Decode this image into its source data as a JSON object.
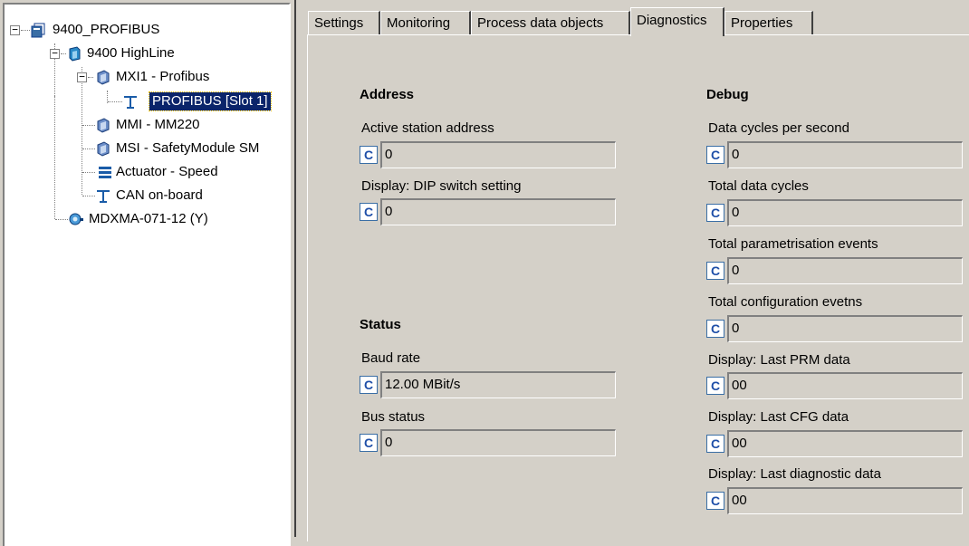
{
  "tree": {
    "items": [
      {
        "label": "9400_PROFIBUS",
        "icon": "project-icon",
        "expander": "−"
      },
      {
        "label": "9400 HighLine",
        "icon": "device-icon",
        "expander": "−"
      },
      {
        "label": "MXI1 - Profibus",
        "icon": "module-icon",
        "expander": "−"
      },
      {
        "label": "PROFIBUS [Slot 1]",
        "icon": "bus-icon"
      },
      {
        "label": "MMI - MM220",
        "icon": "module-icon"
      },
      {
        "label": "MSI - SafetyModule SM",
        "icon": "module-icon"
      },
      {
        "label": "Actuator - Speed",
        "icon": "actuator-icon"
      },
      {
        "label": "CAN on-board",
        "icon": "bus-icon"
      },
      {
        "label": "MDXMA-071-12 (Y)",
        "icon": "motor-icon"
      }
    ]
  },
  "tabs": [
    "Settings",
    "Monitoring",
    "Process data objects",
    "Diagnostics",
    "Properties"
  ],
  "active_tab": "Diagnostics",
  "c_label": "C",
  "address": {
    "title": "Address",
    "active_station_label": "Active station address",
    "active_station_value": "0",
    "dip_label": "Display: DIP switch setting",
    "dip_value": "0"
  },
  "status": {
    "title": "Status",
    "baud_label": "Baud rate",
    "baud_value": "12.00 MBit/s",
    "bus_label": "Bus status",
    "bus_value": "0"
  },
  "debug": {
    "title": "Debug",
    "fields": [
      {
        "label": "Data cycles per second",
        "value": "0"
      },
      {
        "label": "Total data cycles",
        "value": "0"
      },
      {
        "label": "Total parametrisation events",
        "value": "0"
      },
      {
        "label": "Total configuration evetns",
        "value": "0"
      },
      {
        "label": "Display: Last PRM data",
        "value": "00"
      },
      {
        "label": "Display: Last CFG data",
        "value": "00"
      },
      {
        "label": "Display: Last diagnostic data",
        "value": "00"
      }
    ]
  }
}
